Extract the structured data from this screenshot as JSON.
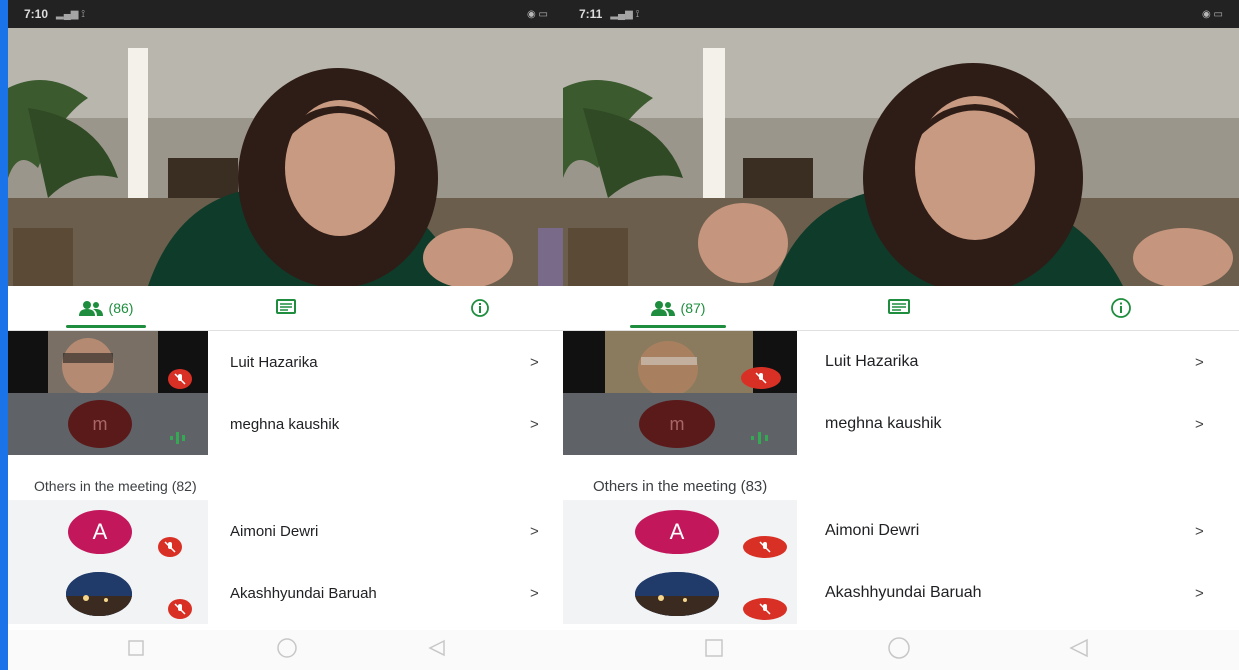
{
  "screens": [
    {
      "status_time": "7:10",
      "participants_count": "(86)",
      "featured": [
        {
          "name": "Luit Hazarika",
          "chevron": ">"
        },
        {
          "name": "meghna kaushik",
          "initial": "m",
          "chevron": ">"
        }
      ],
      "others_label": "Others in the meeting (82)",
      "others": [
        {
          "name": "Aimoni Dewri",
          "initial": "A",
          "chevron": ">"
        },
        {
          "name": "Akashhyundai Baruah",
          "chevron": ">"
        }
      ]
    },
    {
      "status_time": "7:11",
      "participants_count": "(87)",
      "featured": [
        {
          "name": "Luit Hazarika",
          "chevron": ">"
        },
        {
          "name": "meghna kaushik",
          "initial": "m",
          "chevron": ">"
        }
      ],
      "others_label": "Others in the meeting (83)",
      "others": [
        {
          "name": "Aimoni Dewri",
          "initial": "A",
          "chevron": ">"
        },
        {
          "name": "Akashhyundai Baruah",
          "chevron": ">"
        }
      ]
    }
  ],
  "colors": {
    "accent": "#1e8e3e",
    "mute": "#d93025",
    "avatar": "#c2185b",
    "frame": "#1a73e8"
  },
  "icons": [
    "people-icon",
    "chat-icon",
    "info-icon",
    "mic-off-icon",
    "speaking-icon",
    "nav-recent-icon",
    "nav-home-icon",
    "nav-back-icon"
  ]
}
